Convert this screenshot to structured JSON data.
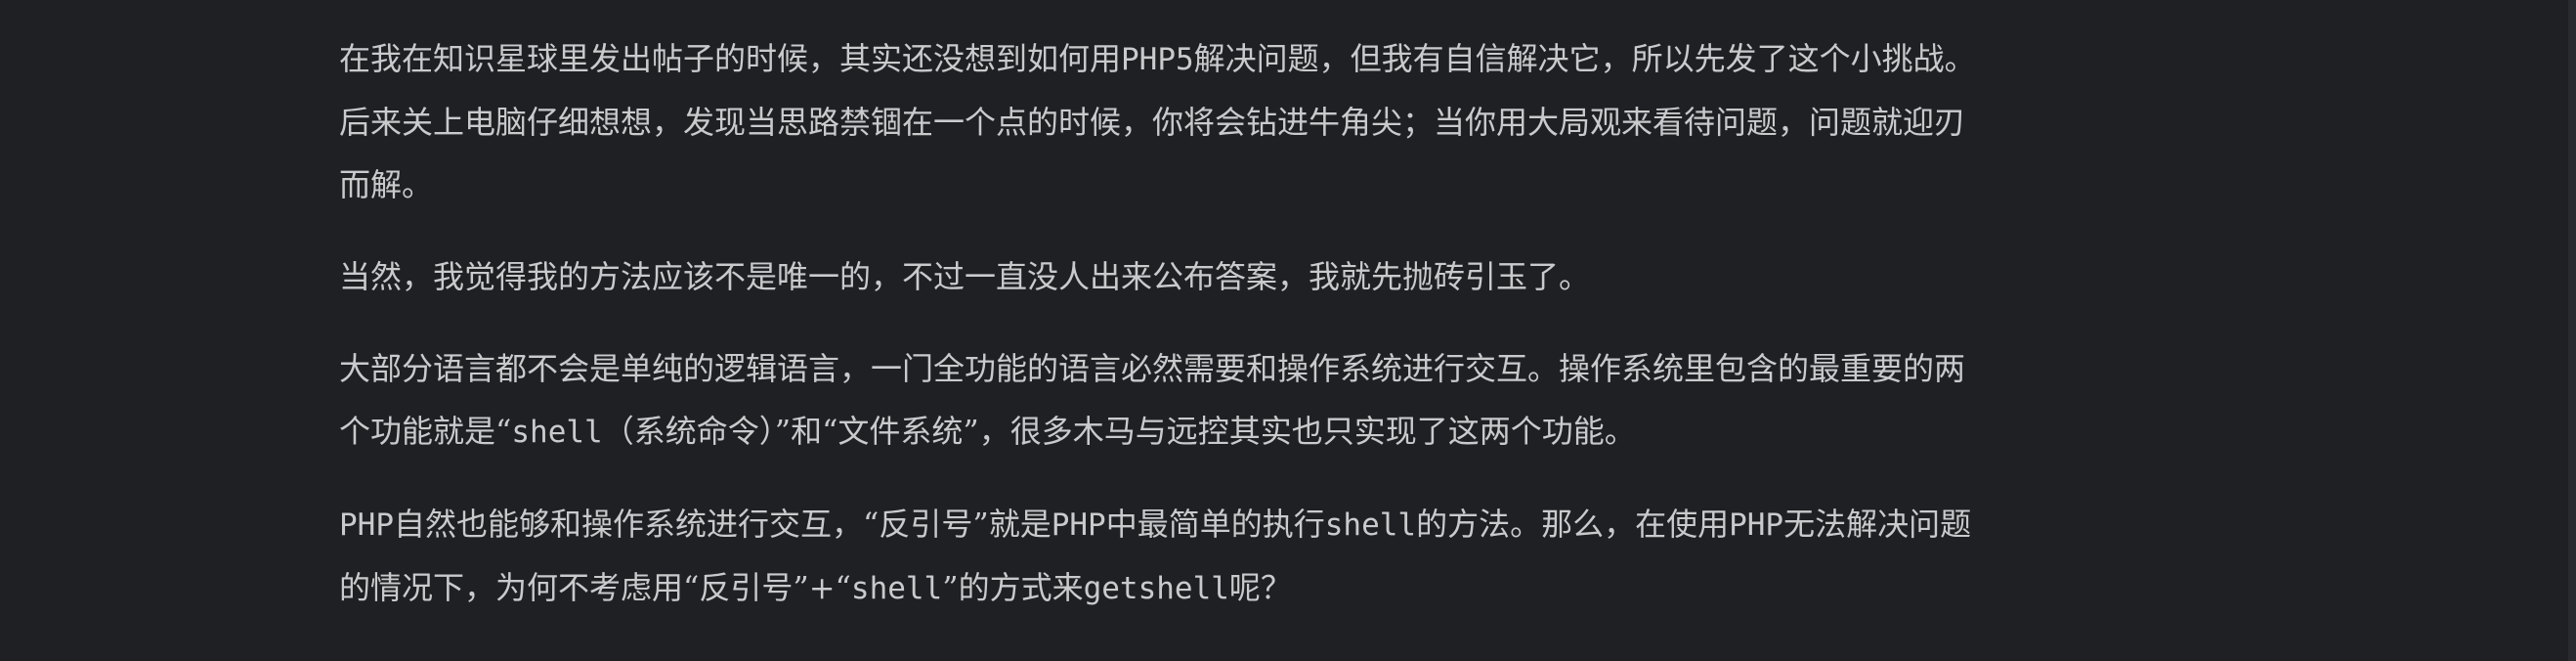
{
  "paragraphs": [
    {
      "lines": [
        [
          "在我在知识星球里发出帖子的时候，其实还没想到如何用",
          "PHP5",
          "解决问题，但我有自信解决它，所以先发了这个小挑战。"
        ],
        [
          "后来关上电脑仔细想想，发现当思路禁锢在一个点的时候，你将会钻进牛角尖；当你用大局观来看待问题，问题就迎刃"
        ],
        [
          "而解。"
        ]
      ]
    },
    {
      "lines": [
        [
          "当然，我觉得我的方法应该不是唯一的，不过一直没人出来公布答案，我就先抛砖引玉了。"
        ]
      ]
    },
    {
      "lines": [
        [
          "大部分语言都不会是单纯的逻辑语言，一门全功能的语言必然需要和操作系统进行交互。操作系统里包含的最重要的两"
        ],
        [
          "个功能就是“",
          "shell",
          "（系统命令）”和“文件系统”，很多木马与远控其实也只实现了这两个功能。"
        ]
      ]
    },
    {
      "lines": [
        [
          "PHP",
          "自然也能够和操作系统进行交互，“反引号”就是",
          "PHP",
          "中最简单的执行",
          "shell",
          "的方法。那么，在使用",
          "PHP",
          "无法解决问题"
        ],
        [
          "的情况下，为何不考虑用“反引号”+“",
          "shell",
          "”的方式来",
          "getshell",
          "呢？"
        ]
      ]
    }
  ]
}
